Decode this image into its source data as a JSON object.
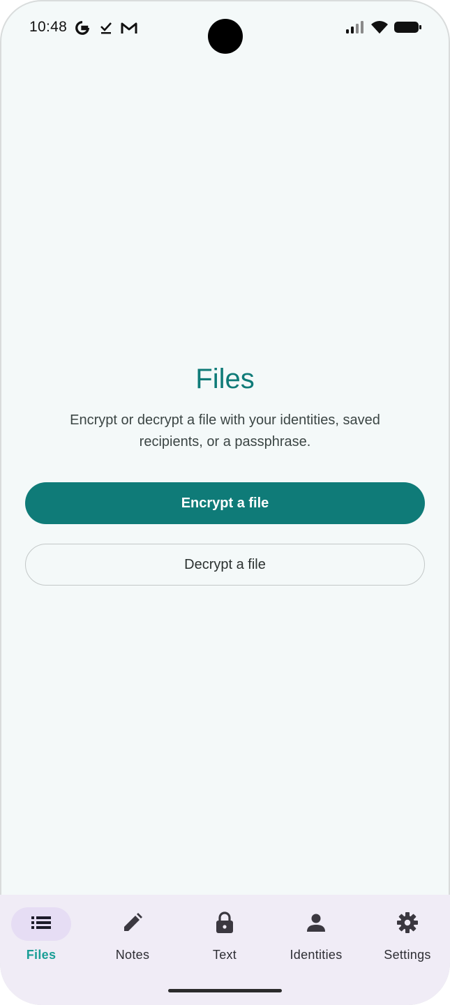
{
  "status_bar": {
    "time": "10:48",
    "notification_icons": [
      "google-icon",
      "check-icon",
      "gmail-icon"
    ],
    "right_icons": [
      "signal-icon",
      "wifi-icon",
      "battery-icon"
    ]
  },
  "main": {
    "title": "Files",
    "description": "Encrypt or decrypt a file with your identities, saved recipients, or a passphrase.",
    "encrypt_button": "Encrypt a file",
    "decrypt_button": "Decrypt a file"
  },
  "bottom_nav": {
    "items": [
      {
        "label": "Files",
        "icon": "list-icon",
        "active": true
      },
      {
        "label": "Notes",
        "icon": "pencil-icon",
        "active": false
      },
      {
        "label": "Text",
        "icon": "lock-icon",
        "active": false
      },
      {
        "label": "Identities",
        "icon": "person-icon",
        "active": false
      },
      {
        "label": "Settings",
        "icon": "gear-icon",
        "active": false
      }
    ]
  },
  "colors": {
    "accent": "#0f7b78",
    "active_nav_label": "#1a9e96",
    "active_nav_pill": "#e6ddf4",
    "nav_background": "#f0ecf6",
    "page_background": "#f4f9f9"
  }
}
